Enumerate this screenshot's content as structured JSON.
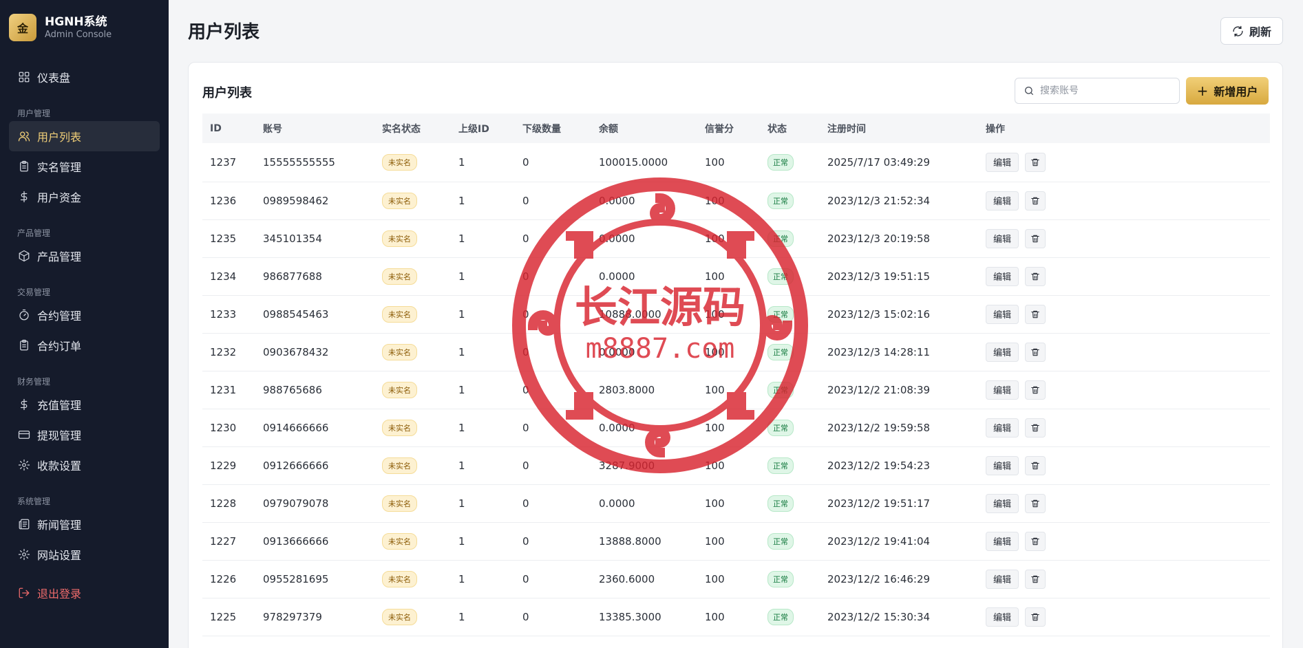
{
  "brand": {
    "logo": "金",
    "title": "HGNH系统",
    "subtitle": "Admin Console"
  },
  "sidebar": {
    "dashboard": "仪表盘",
    "groups": {
      "users": "用户管理",
      "products": "产品管理",
      "trade": "交易管理",
      "finance": "财务管理",
      "system": "系统管理"
    },
    "items": {
      "user_list": "用户列表",
      "realname": "实名管理",
      "user_funds": "用户资金",
      "product_mgmt": "产品管理",
      "contract_mgmt": "合约管理",
      "contract_orders": "合约订单",
      "recharge": "充值管理",
      "withdraw": "提现管理",
      "payment_settings": "收款设置",
      "news": "新闻管理",
      "site_settings": "网站设置",
      "logout": "退出登录"
    }
  },
  "header": {
    "title": "用户列表",
    "refresh_label": "刷新"
  },
  "card": {
    "title": "用户列表",
    "search_placeholder": "搜索账号",
    "add_label": "新增用户"
  },
  "table": {
    "columns": [
      "ID",
      "账号",
      "实名状态",
      "上级ID",
      "下级数量",
      "余额",
      "信誉分",
      "状态",
      "注册时间",
      "操作"
    ],
    "edit_label": "编辑",
    "rows": [
      {
        "id": "1237",
        "account": "15555555555",
        "realname": "未实名",
        "parent": "1",
        "children": "0",
        "balance": "100015.0000",
        "score": "100",
        "status": "正常",
        "time": "2025/7/17 03:49:29"
      },
      {
        "id": "1236",
        "account": "0989598462",
        "realname": "未实名",
        "parent": "1",
        "children": "0",
        "balance": "0.0000",
        "score": "100",
        "status": "正常",
        "time": "2023/12/3 21:52:34"
      },
      {
        "id": "1235",
        "account": "345101354",
        "realname": "未实名",
        "parent": "1",
        "children": "0",
        "balance": "0.0000",
        "score": "100",
        "status": "正常",
        "time": "2023/12/3 20:19:58"
      },
      {
        "id": "1234",
        "account": "986877688",
        "realname": "未实名",
        "parent": "1",
        "children": "0",
        "balance": "0.0000",
        "score": "100",
        "status": "正常",
        "time": "2023/12/3 19:51:15"
      },
      {
        "id": "1233",
        "account": "0988545463",
        "realname": "未实名",
        "parent": "1",
        "children": "0",
        "balance": "10888.0000",
        "score": "100",
        "status": "正常",
        "time": "2023/12/3 15:02:16"
      },
      {
        "id": "1232",
        "account": "0903678432",
        "realname": "未实名",
        "parent": "1",
        "children": "0",
        "balance": "0.0000",
        "score": "100",
        "status": "正常",
        "time": "2023/12/3 14:28:11"
      },
      {
        "id": "1231",
        "account": "988765686",
        "realname": "未实名",
        "parent": "1",
        "children": "0",
        "balance": "2803.8000",
        "score": "100",
        "status": "正常",
        "time": "2023/12/2 21:08:39"
      },
      {
        "id": "1230",
        "account": "0914666666",
        "realname": "未实名",
        "parent": "1",
        "children": "0",
        "balance": "0.0000",
        "score": "100",
        "status": "正常",
        "time": "2023/12/2 19:59:58"
      },
      {
        "id": "1229",
        "account": "0912666666",
        "realname": "未实名",
        "parent": "1",
        "children": "0",
        "balance": "3287.9000",
        "score": "100",
        "status": "正常",
        "time": "2023/12/2 19:54:23"
      },
      {
        "id": "1228",
        "account": "0979079078",
        "realname": "未实名",
        "parent": "1",
        "children": "0",
        "balance": "0.0000",
        "score": "100",
        "status": "正常",
        "time": "2023/12/2 19:51:17"
      },
      {
        "id": "1227",
        "account": "0913666666",
        "realname": "未实名",
        "parent": "1",
        "children": "0",
        "balance": "13888.8000",
        "score": "100",
        "status": "正常",
        "time": "2023/12/2 19:41:04"
      },
      {
        "id": "1226",
        "account": "0955281695",
        "realname": "未实名",
        "parent": "1",
        "children": "0",
        "balance": "2360.6000",
        "score": "100",
        "status": "正常",
        "time": "2023/12/2 16:46:29"
      },
      {
        "id": "1225",
        "account": "978297379",
        "realname": "未实名",
        "parent": "1",
        "children": "0",
        "balance": "13385.3000",
        "score": "100",
        "status": "正常",
        "time": "2023/12/2 15:30:34"
      }
    ]
  },
  "watermark": {
    "line1": "长江源码",
    "line2": "m8887.com"
  },
  "colors": {
    "sidebar_bg": "#151b2b",
    "accent_gold": "#f1cf78",
    "watermark_red": "#d8242f"
  }
}
